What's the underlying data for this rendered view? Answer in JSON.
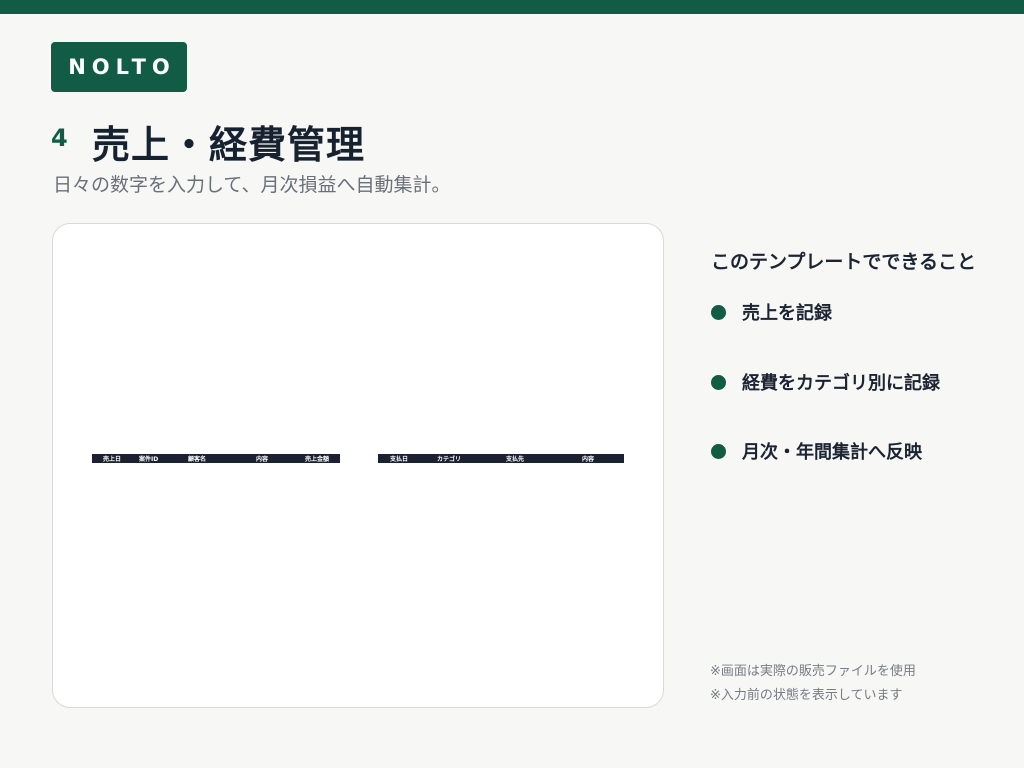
{
  "brand": {
    "logo_text": "NOLTO",
    "accent_color": "#125c45"
  },
  "header": {
    "section_number": "4",
    "title": "売上・経費管理",
    "subtitle": "日々の数字を入力して、月次損益へ自動集計。"
  },
  "preview": {
    "sales_table": {
      "columns": [
        "売上日",
        "案件ID",
        "顧客名",
        "内容",
        "売上金額"
      ]
    },
    "expense_table": {
      "columns": [
        "支払日",
        "カテゴリ",
        "支払先",
        "内容"
      ]
    }
  },
  "features": {
    "heading": "このテンプレートでできること",
    "items": [
      {
        "label": "売上を記録"
      },
      {
        "label": "経費をカテゴリ別に記録"
      },
      {
        "label": "月次・年間集計へ反映"
      }
    ]
  },
  "notes": [
    "※画面は実際の販売ファイルを使用",
    "※入力前の状態を表示しています"
  ]
}
